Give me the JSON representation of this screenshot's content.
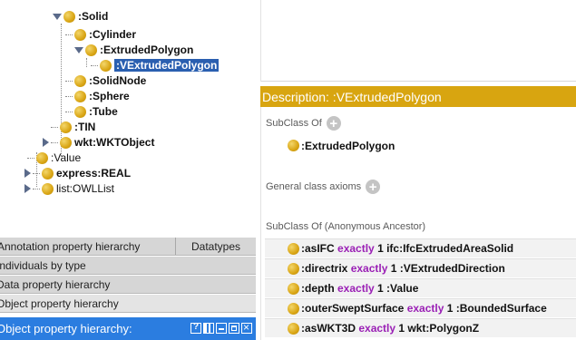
{
  "tree": {
    "nodes": [
      {
        "label": ":Solid"
      },
      {
        "label": ":Cylinder"
      },
      {
        "label": ":ExtrudedPolygon"
      },
      {
        "label": ":VExtrudedPolygon"
      },
      {
        "label": ":SolidNode"
      },
      {
        "label": ":Sphere"
      },
      {
        "label": ":Tube"
      },
      {
        "label": ":TIN"
      },
      {
        "label": "wkt:WKTObject"
      },
      {
        "label": ":Value"
      },
      {
        "label": "express:REAL"
      },
      {
        "label": "list:OWLList"
      }
    ]
  },
  "tabs": {
    "annotation": "Annotation property hierarchy",
    "datatypes": "Datatypes",
    "individuals": "Individuals by type",
    "data_prop": "Data property hierarchy",
    "object_prop": "Object property hierarchy",
    "view_title": "Object property hierarchy:"
  },
  "description": {
    "header": "Description: :VExtrudedPolygon",
    "subclass_of": "SubClass Of",
    "subclass_value": ":ExtrudedPolygon",
    "general_axioms": "General class axioms",
    "anon_ancestor": "SubClass Of (Anonymous Ancestor)",
    "restrictions": [
      {
        "prop": ":asIFC",
        "kw": "exactly",
        "rest": "1 ifc:IfcExtrudedAreaSolid"
      },
      {
        "prop": ":directrix",
        "kw": "exactly",
        "rest": "1 :VExtrudedDirection"
      },
      {
        "prop": ":depth",
        "kw": "exactly",
        "rest": "1 :Value"
      },
      {
        "prop": ":outerSweptSurface",
        "kw": "exactly",
        "rest": "1 :BoundedSurface"
      },
      {
        "prop": ":asWKT3D",
        "kw": "exactly",
        "rest": "1  wkt:PolygonZ"
      }
    ]
  },
  "colors": {
    "selection": "#2a5fb0",
    "header": "#d8a510",
    "viewbar": "#2b7de0",
    "keyword": "#9a1fb5",
    "class_dot": "#d9a514"
  }
}
